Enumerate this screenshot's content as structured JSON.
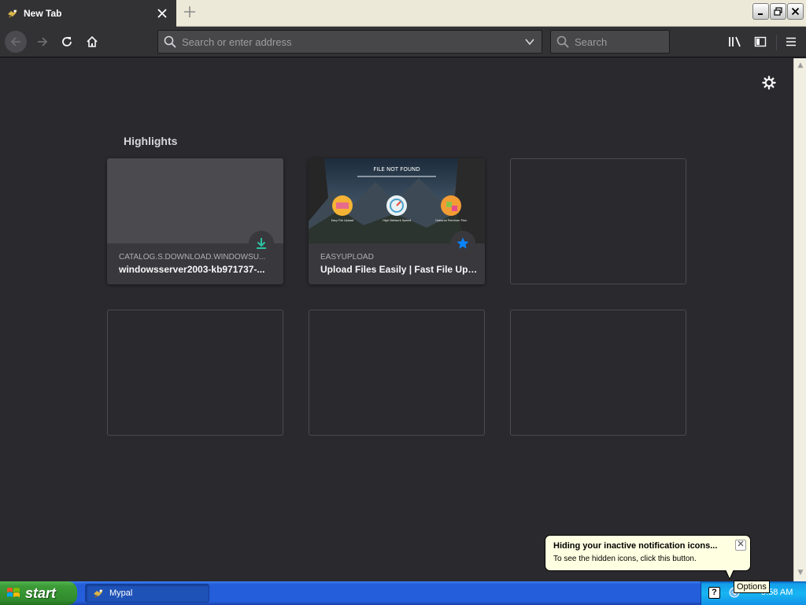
{
  "browser": {
    "tab_title": "New Tab",
    "urlbar_placeholder": "Search or enter address",
    "searchbar_placeholder": "Search"
  },
  "newtab": {
    "section_title": "Highlights",
    "cards": [
      {
        "host": "CATALOG.S.DOWNLOAD.WINDOWSU...",
        "title": "windowsserver2003-kb971737-...",
        "badge": "download-icon"
      },
      {
        "host": "EASYUPLOAD",
        "title": "Upload Files Easily | Fast File Upl...",
        "badge": "bookmark-star-icon",
        "thumbnail": {
          "heading": "FILE NOT FOUND",
          "features": [
            "Easy File Upload",
            "High Network Speed",
            "Optional Premium Plan"
          ]
        }
      }
    ]
  },
  "notification": {
    "title": "Hiding your inactive notification icons...",
    "body": "To see the hidden icons, click this button.",
    "tooltip": "Options"
  },
  "taskbar": {
    "start_label": "start",
    "task_label": "Mypal",
    "clock": "5:58 AM"
  },
  "colors": {
    "content_bg": "#2a2a2e",
    "toolbar_bg": "#323234",
    "download_badge": "#2ac3a2",
    "bookmark_badge": "#0a84ff",
    "xp_start_green": "#3c9c37",
    "xp_taskbar_blue": "#245edb"
  }
}
